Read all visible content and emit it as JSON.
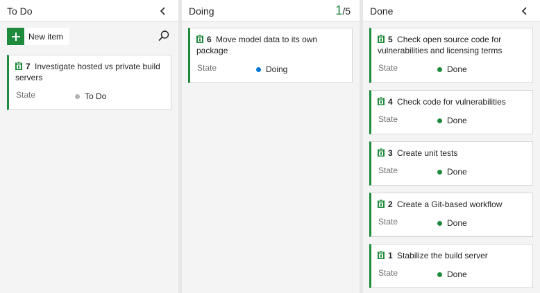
{
  "colors": {
    "accent_green": "#1e8a3c",
    "todo_dot": "#b2b2b2",
    "doing_dot": "#0078d4",
    "done_dot": "#1e8a3c"
  },
  "columns": {
    "todo": {
      "title": "To Do",
      "new_item_label": "New item",
      "cards": [
        {
          "id": "7",
          "title": "Investigate hosted vs private build servers",
          "state_label": "State",
          "state": "To Do"
        }
      ]
    },
    "doing": {
      "title": "Doing",
      "wip_count": "1",
      "wip_limit": "/5",
      "cards": [
        {
          "id": "6",
          "title": "Move model data to its own package",
          "state_label": "State",
          "state": "Doing"
        }
      ]
    },
    "done": {
      "title": "Done",
      "cards": [
        {
          "id": "5",
          "title": "Check open source code for vulnerabilities and licensing terms",
          "state_label": "State",
          "state": "Done"
        },
        {
          "id": "4",
          "title": "Check code for vulnerabilities",
          "state_label": "State",
          "state": "Done"
        },
        {
          "id": "3",
          "title": "Create unit tests",
          "state_label": "State",
          "state": "Done"
        },
        {
          "id": "2",
          "title": "Create a Git-based workflow",
          "state_label": "State",
          "state": "Done"
        },
        {
          "id": "1",
          "title": "Stabilize the build server",
          "state_label": "State",
          "state": "Done"
        }
      ]
    }
  }
}
